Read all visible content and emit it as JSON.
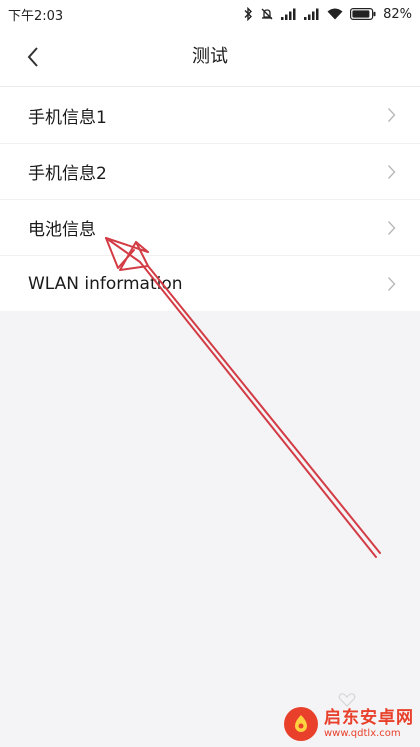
{
  "status_bar": {
    "time": "下午2:03",
    "battery_percent": "82%",
    "icons": [
      "bluetooth-icon",
      "mute-icon",
      "signal-icon",
      "signal-icon",
      "wifi-icon",
      "battery-icon"
    ]
  },
  "header": {
    "title": "测试",
    "back_icon": "chevron-left-icon"
  },
  "list": {
    "items": [
      {
        "label": "手机信息1"
      },
      {
        "label": "手机信息2"
      },
      {
        "label": "电池信息"
      },
      {
        "label": "WLAN information"
      }
    ]
  },
  "watermark": {
    "title": "启东安卓网",
    "url": "www.qdtlx.com"
  },
  "colors": {
    "background": "#f4f4f6",
    "surface": "#ffffff",
    "annotation": "#d33c45",
    "watermark": "#e8402a"
  }
}
